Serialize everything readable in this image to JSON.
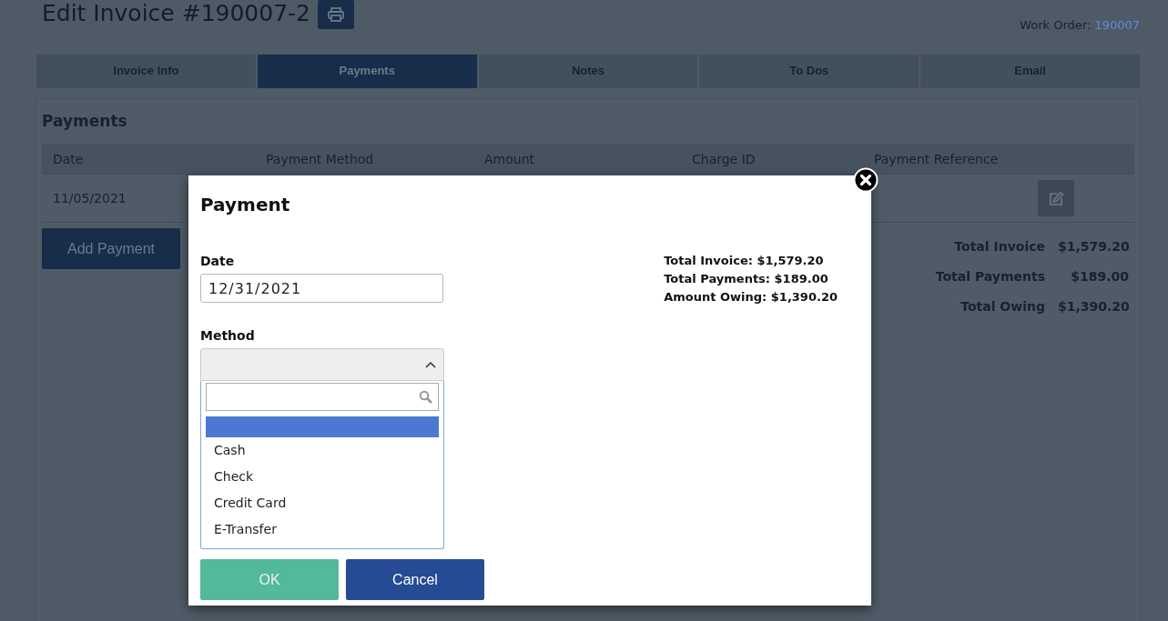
{
  "page": {
    "title": "Edit Invoice #190007-2",
    "work_order_label": "Work Order:",
    "work_order_value": "190007"
  },
  "tabs": [
    {
      "label": "Invoice Info",
      "selected": false
    },
    {
      "label": "Payments",
      "selected": true
    },
    {
      "label": "Notes",
      "selected": false
    },
    {
      "label": "To Dos",
      "selected": false
    },
    {
      "label": "Email",
      "selected": false
    }
  ],
  "payments_panel": {
    "heading": "Payments",
    "columns": [
      "Date",
      "Payment Method",
      "Amount",
      "Charge ID",
      "Payment Reference"
    ],
    "rows": [
      {
        "date": "11/05/2021"
      }
    ],
    "add_button": "Add Payment",
    "totals": [
      {
        "label": "Total Invoice",
        "value": "$1,579.20"
      },
      {
        "label": "Total Payments",
        "value": "$189.00"
      },
      {
        "label": "Total Owing",
        "value": "$1,390.20"
      }
    ]
  },
  "modal": {
    "title": "Payment",
    "date_label": "Date",
    "date_value": "12/31/2021",
    "method_label": "Method",
    "dropdown": {
      "expanded": true,
      "blank_option_highlighted": true,
      "options": [
        "Cash",
        "Check",
        "Credit Card",
        "E-Transfer"
      ]
    },
    "summary": [
      "Total Invoice: $1,579.20",
      "Total Payments: $189.00",
      "Amount Owing: $1,390.20"
    ],
    "ok_button": "OK",
    "cancel_button": "Cancel"
  }
}
